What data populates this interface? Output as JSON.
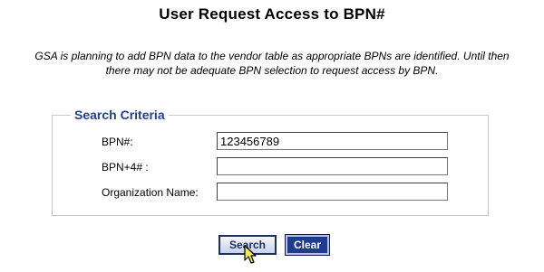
{
  "page": {
    "title": "User Request Access to BPN#",
    "notice_line1": "GSA is planning to add BPN data to the vendor table as appropriate BPNs are identified. Until then",
    "notice_line2": "there may not be adequate BPN selection to request access by BPN."
  },
  "search_criteria": {
    "legend": "Search Criteria",
    "fields": [
      {
        "label": "BPN#:",
        "value": "123456789",
        "placeholder": ""
      },
      {
        "label": "BPN+4# :",
        "value": "",
        "placeholder": ""
      },
      {
        "label": "Organization Name:",
        "value": "",
        "placeholder": ""
      }
    ]
  },
  "buttons": {
    "search_label": "Search",
    "clear_label": "Clear"
  },
  "colors": {
    "legend_text": "#1f3f93",
    "clear_button_bg": "#1f3b8f",
    "search_button_border": "#1c2c6c",
    "box_border": "#c8c8c8"
  },
  "icons": {
    "cursor": "arrow-cursor-icon"
  }
}
